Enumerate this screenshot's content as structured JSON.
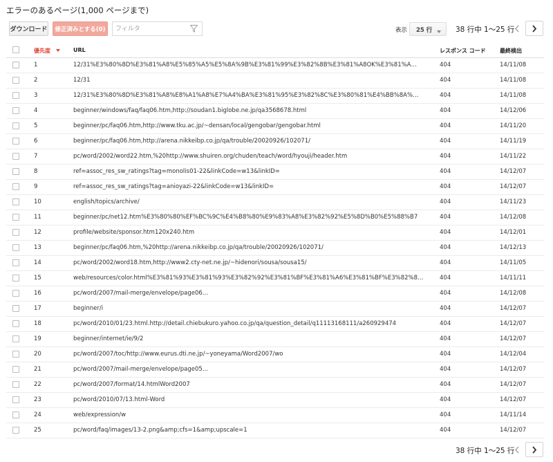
{
  "page_title": "エラーのあるページ(1,000 ページまで)",
  "toolbar": {
    "download_label": "ダウンロード",
    "mark_fixed_label": "修正済みとする(0)",
    "filter_placeholder": "フィルタ",
    "show_label": "表示",
    "rows_per_page": "25 行",
    "pagination_text": "38 行中 1〜25 行"
  },
  "columns": {
    "priority": "優先度",
    "url": "URL",
    "response_code": "レスポンス コード",
    "detected": "最終検出"
  },
  "rows": [
    {
      "num": "1",
      "url": "12/31%E3%80%8D%E3%81%A8%E5%85%A5%E5%8A%9B%E3%81%99%E3%82%8B%E3%81%A8OK%E3%81%A…",
      "code": "404",
      "date": "14/11/08"
    },
    {
      "num": "2",
      "url": "12/31",
      "code": "404",
      "date": "14/11/08"
    },
    {
      "num": "3",
      "url": "12/31%E3%80%8D%E3%81%A8%E8%A1%A8%E7%A4%BA%E3%81%95%E3%82%8C%E3%80%81%E4%BB%8A%…",
      "code": "404",
      "date": "14/11/08"
    },
    {
      "num": "4",
      "url": "beginner/windows/faq/faq06.htm,http://soudan1.biglobe.ne.jp/qa3568678.html",
      "code": "404",
      "date": "14/12/06"
    },
    {
      "num": "5",
      "url": "beginner/pc/faq06.htm,http://www.tku.ac.jp/~densan/local/gengobar/gengobar.html",
      "code": "404",
      "date": "14/11/20"
    },
    {
      "num": "6",
      "url": "beginner/pc/faq06.htm,http://arena.nikkeibp.co.jp/qa/trouble/20020926/102071/",
      "code": "404",
      "date": "14/11/19"
    },
    {
      "num": "7",
      "url": "pc/word/2002/word22.htm,%20http://www.shuiren.org/chuden/teach/word/hyouji/header.htm",
      "code": "404",
      "date": "14/11/22"
    },
    {
      "num": "8",
      "url": "ref=assoc_res_sw_ratings?tag=monolis01-22&linkCode=w13&linkID=",
      "code": "404",
      "date": "14/12/07"
    },
    {
      "num": "9",
      "url": "ref=assoc_res_sw_ratings?tag=anioyazi-22&linkCode=w13&linkID=",
      "code": "404",
      "date": "14/12/07"
    },
    {
      "num": "10",
      "url": "english/topics/archive/",
      "code": "404",
      "date": "14/11/23"
    },
    {
      "num": "11",
      "url": "beginner/pc/net12.htm%E3%80%80%EF%BC%9C%E4%B8%80%E9%83%A8%E3%82%92%E5%8D%B0%E5%88%B7",
      "code": "404",
      "date": "14/12/08"
    },
    {
      "num": "12",
      "url": "profile/website/sponsor.htm120x240.htm",
      "code": "404",
      "date": "14/12/01"
    },
    {
      "num": "13",
      "url": "beginner/pc/faq06.htm,%20http://arena.nikkeibp.co.jp/qa/trouble/20020926/102071/",
      "code": "404",
      "date": "14/12/13"
    },
    {
      "num": "14",
      "url": "pc/word/2002/word18.htm,http://www2.cty-net.ne.jp/~hidenori/sousa/sousa15/",
      "code": "404",
      "date": "14/11/05"
    },
    {
      "num": "15",
      "url": "web/resources/color.html%E3%81%93%E3%81%93%E3%82%92%E3%81%BF%E3%81%A6%E3%81%BF%E3%82%8…",
      "code": "404",
      "date": "14/11/11"
    },
    {
      "num": "16",
      "url": "pc/word/2007/mail-merge/envelope/page06…",
      "code": "404",
      "date": "14/12/08"
    },
    {
      "num": "17",
      "url": "beginner/i",
      "code": "404",
      "date": "14/12/07"
    },
    {
      "num": "18",
      "url": "pc/word/2010/01/23.html.http://detail.chiebukuro.yahoo.co.jp/qa/question_detail/q11113168111/a260929474",
      "code": "404",
      "date": "14/12/07"
    },
    {
      "num": "19",
      "url": "beginner/internet/ie/9/2",
      "code": "404",
      "date": "14/12/07"
    },
    {
      "num": "20",
      "url": "pc/word/2007/toc/http://www.eurus.dti.ne.jp/~yoneyama/Word2007/wo",
      "code": "404",
      "date": "14/12/04"
    },
    {
      "num": "21",
      "url": "pc/word/2007/mail-merge/envelope/page05…",
      "code": "404",
      "date": "14/12/07"
    },
    {
      "num": "22",
      "url": "pc/word/2007/format/14.htmlWord2007",
      "code": "404",
      "date": "14/12/07"
    },
    {
      "num": "23",
      "url": "pc/word/2010/07/13.html-Word",
      "code": "404",
      "date": "14/12/07"
    },
    {
      "num": "24",
      "url": "web/expression/w",
      "code": "404",
      "date": "14/11/14"
    },
    {
      "num": "25",
      "url": "pc/word/faq/images/13-2.png&amp;cfs=1&amp;upscale=1",
      "code": "404",
      "date": "14/12/07"
    }
  ],
  "footer": {
    "pagination_text": "38 行中 1〜25 行"
  },
  "colors": {
    "accent_red": "#dd4b39",
    "mark_button": "#f1a89d"
  }
}
